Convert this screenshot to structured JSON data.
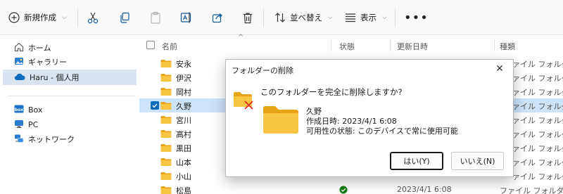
{
  "toolbar": {
    "new_label": "新規作成",
    "sort_label": "並べ替え",
    "view_label": "表示",
    "more_label": "•••"
  },
  "sidebar": {
    "items": [
      {
        "label": "ホーム",
        "icon": "home-icon"
      },
      {
        "label": "ギャラリー",
        "icon": "gallery-icon"
      },
      {
        "label": "Haru - 個人用",
        "icon": "onedrive-icon"
      },
      {
        "label": "Box",
        "icon": "box-icon"
      },
      {
        "label": "PC",
        "icon": "pc-icon"
      },
      {
        "label": "ネットワーク",
        "icon": "network-icon"
      }
    ]
  },
  "filelist": {
    "columns": {
      "name": "名前",
      "status": "状態",
      "modified": "更新日時",
      "type": "種類"
    },
    "rows": [
      {
        "name": "安永",
        "type": "ァイル フォルダー",
        "date": "",
        "status": ""
      },
      {
        "name": "伊沢",
        "type": "ァイル フォルダー",
        "date": "",
        "status": ""
      },
      {
        "name": "岡村",
        "type": "ァイル フォルダー",
        "date": "",
        "status": ""
      },
      {
        "name": "久野",
        "type": "ァイル フォルダー",
        "date": "",
        "status": "",
        "selected": true
      },
      {
        "name": "宮川",
        "type": "ァイル フォルダー",
        "date": "",
        "status": ""
      },
      {
        "name": "高村",
        "type": "ァイル フォルダー",
        "date": "",
        "status": ""
      },
      {
        "name": "黒田",
        "type": "ァイル フォルダー",
        "date": "",
        "status": ""
      },
      {
        "name": "山本",
        "type": "ァイル フォルダー",
        "date": "",
        "status": ""
      },
      {
        "name": "小山",
        "type": "ァイル フォルダー",
        "date": "",
        "status": ""
      },
      {
        "name": "松島",
        "type": "ファイル フォルダー",
        "date": "2023/4/1 6:08",
        "status": "synced"
      }
    ]
  },
  "dialog": {
    "title": "フォルダーの削除",
    "close_label": "✕",
    "question": "このフォルダーを完全に削除しますか?",
    "folder_name": "久野",
    "created": "作成日時: 2023/4/1 6:08",
    "availability": "可用性の状態: このデバイスで常に使用可能",
    "yes_label": "はい(Y)",
    "no_label": "いいえ(N)"
  },
  "colors": {
    "accent": "#0f6cbd",
    "folder": "#f8c444",
    "folder_dark": "#e8a317",
    "delete_x": "#d93025",
    "synced": "#107c10"
  }
}
